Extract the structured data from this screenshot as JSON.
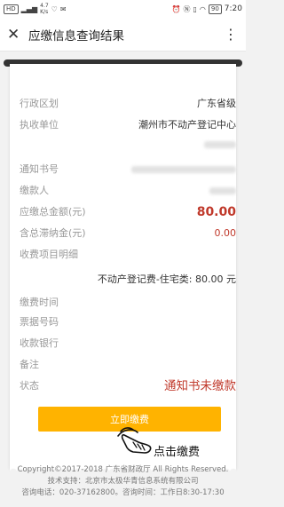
{
  "status_bar": {
    "left_tag": "HD",
    "speed": "4.7",
    "speed_unit": "K/s",
    "battery": "90",
    "time": "7:20"
  },
  "nav": {
    "title": "应缴信息查询结果",
    "close_icon": "close-icon",
    "more_icon": "more-icon"
  },
  "fields": {
    "region_label": "行政区划",
    "region_value": "广东省级",
    "unit_label": "执收单位",
    "unit_value": "潮州市不动产登记中心",
    "notice_no_label": "通知书号",
    "payer_label": "缴款人",
    "total_label": "应缴总金额(元)",
    "total_value": "80.00",
    "late_fee_label": "含总滞纳金(元)",
    "late_fee_value": "0.00",
    "items_label": "收费项目明细",
    "item_line": "不动产登记费-住宅类: 80.00 元",
    "pay_time_label": "缴费时间",
    "receipt_no_label": "票据号码",
    "bank_label": "收款银行",
    "remark_label": "备注",
    "status_label": "状态",
    "status_value": "通知书未缴款"
  },
  "action": {
    "pay_button": "立即缴费",
    "hint": "点击缴费",
    "hand_icon": "hand-pointer-icon"
  },
  "footer": {
    "copyright": "Copyright©2017-2018 广东省财政厅 All Rights Reserved.",
    "support": "技术支持：北京市太极华青信息系统有限公司",
    "phone": "咨询电话：020-37162800。咨询时间：工作日8:30-17:30"
  },
  "colors": {
    "accent_red": "#c0392b",
    "button": "#ffb300"
  }
}
